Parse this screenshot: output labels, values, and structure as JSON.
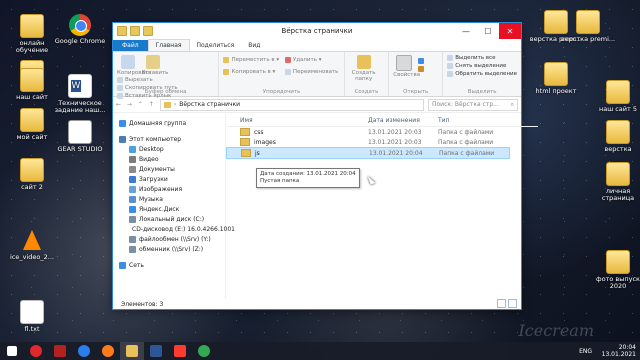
{
  "desktop": {
    "icons_left": [
      {
        "label": "онлайн обучение",
        "type": "folder"
      },
      {
        "label": "Google Chrome",
        "type": "chrome"
      },
      {
        "label": "",
        "type": "folder"
      },
      {
        "label": "наш сайт",
        "type": "folder"
      },
      {
        "label": "Техническое задание наш...",
        "type": "doc"
      },
      {
        "label": "мой сайт",
        "type": "folder"
      },
      {
        "label": "GEAR STUDIO",
        "type": "gear"
      },
      {
        "label": "сайт 2",
        "type": "folder"
      },
      {
        "label": "ice_video_2...",
        "type": "vlc"
      },
      {
        "label": "fl.txt",
        "type": "txt"
      }
    ],
    "icons_right": [
      {
        "label": "верстка prem...",
        "type": "folder"
      },
      {
        "label": "верстка premi...",
        "type": "folder"
      },
      {
        "label": "html проект",
        "type": "folder"
      },
      {
        "label": "наш сайт 5",
        "type": "folder"
      },
      {
        "label": "верстка",
        "type": "folder"
      },
      {
        "label": "личная страница",
        "type": "folder"
      },
      {
        "label": "фото выпуск 2020",
        "type": "folder"
      }
    ]
  },
  "explorer": {
    "title": "Вёрстка странички",
    "tabs": [
      "Файл",
      "Главная",
      "Поделиться",
      "Вид"
    ],
    "ribbon": {
      "clipboard": {
        "name": "Буфер обмена",
        "copy": "Копировать",
        "paste": "Вставить",
        "cut": "Вырезать",
        "copy_path": "Скопировать путь",
        "paste_shortcut": "Вставить ярлык"
      },
      "organize": {
        "name": "Упорядочить",
        "move_to": "Переместить в ▾",
        "copy_to": "Копировать в ▾",
        "delete": "Удалить ▾",
        "rename": "Переименовать"
      },
      "create": {
        "name": "Создать",
        "new_folder": "Создать папку"
      },
      "open": {
        "name": "Открыть",
        "properties": "Свойства"
      },
      "select": {
        "name": "Выделить",
        "select_all": "Выделить все",
        "select_none": "Снять выделение",
        "invert": "Обратить выделение"
      }
    },
    "address": {
      "path": "Вёрстка странички",
      "search_placeholder": "Поиск: Вёрстка стр..."
    },
    "sidebar": [
      {
        "label": "Домашняя группа",
        "color": "#3a8ee6",
        "indent": 0
      },
      {
        "label": "Этот компьютер",
        "color": "#4a7fb5",
        "indent": 0
      },
      {
        "label": "Desktop",
        "color": "#4aa3df",
        "indent": 1
      },
      {
        "label": "Видео",
        "color": "#7a7a7a",
        "indent": 1
      },
      {
        "label": "Документы",
        "color": "#8a8a8a",
        "indent": 1
      },
      {
        "label": "Загрузки",
        "color": "#3a7bd5",
        "indent": 1
      },
      {
        "label": "Изображения",
        "color": "#6aa0d8",
        "indent": 1
      },
      {
        "label": "Музыка",
        "color": "#5d8fd0",
        "indent": 1
      },
      {
        "label": "Яндекс.Диск",
        "color": "#3a8ee6",
        "indent": 1
      },
      {
        "label": "Локальный диск (C:)",
        "color": "#7a8fa3",
        "indent": 1
      },
      {
        "label": "CD-дисковод (E:) 16.0.4266.1001",
        "color": "#c0392b",
        "indent": 1
      },
      {
        "label": "файлообмен (\\\\Srv) (Y:)",
        "color": "#7a8fa3",
        "indent": 1
      },
      {
        "label": "обменник (\\\\Srv) (Z:)",
        "color": "#7a8fa3",
        "indent": 1
      },
      {
        "label": "Сеть",
        "color": "#3a8ee6",
        "indent": 0
      }
    ],
    "columns": [
      "Имя",
      "Дата изменения",
      "Тип"
    ],
    "files": [
      {
        "name": "css",
        "date": "13.01.2021 20:03",
        "type": "Папка с файлами"
      },
      {
        "name": "images",
        "date": "13.01.2021 20:03",
        "type": "Папка с файлами"
      },
      {
        "name": "js",
        "date": "13.01.2021 20:04",
        "type": "Папка с файлами"
      }
    ],
    "tooltip": {
      "line1": "Дата создания: 13.01.2021 20:04",
      "line2": "Пустая папка"
    },
    "status": "Элементов: 3"
  },
  "taskbar": {
    "apps": [
      {
        "name": "opera",
        "color": "#e0282d"
      },
      {
        "name": "filezilla",
        "color": "#b52121"
      },
      {
        "name": "edge",
        "color": "#2b7de9"
      },
      {
        "name": "firefox",
        "color": "#ff7a1a"
      },
      {
        "name": "explorer",
        "color": "#e8c15a"
      },
      {
        "name": "word",
        "color": "#2b5797"
      },
      {
        "name": "yandex",
        "color": "#ff3b30"
      },
      {
        "name": "chrome",
        "color": "#34a853"
      }
    ],
    "lang": "ENG",
    "time": "20:04",
    "date": "13.01.2021"
  }
}
